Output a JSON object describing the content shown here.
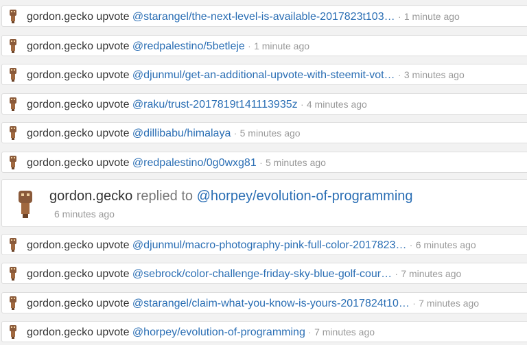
{
  "feed": [
    {
      "user": "gordon.gecko",
      "action": "upvote",
      "target": "@starangel/the-next-level-is-available-2017823t103…",
      "time": "1 minute ago"
    },
    {
      "user": "gordon.gecko",
      "action": "upvote",
      "target": "@redpalestino/5betleje",
      "time": "1 minute ago"
    },
    {
      "user": "gordon.gecko",
      "action": "upvote",
      "target": "@djunmul/get-an-additional-upvote-with-steemit-vot…",
      "time": "3 minutes ago"
    },
    {
      "user": "gordon.gecko",
      "action": "upvote",
      "target": "@raku/trust-2017819t141113935z",
      "time": "4 minutes ago"
    },
    {
      "user": "gordon.gecko",
      "action": "upvote",
      "target": "@dillibabu/himalaya",
      "time": "5 minutes ago"
    },
    {
      "user": "gordon.gecko",
      "action": "upvote",
      "target": "@redpalestino/0g0wxg81",
      "time": "5 minutes ago"
    },
    {
      "user": "gordon.gecko",
      "action": "replied to",
      "target": "@horpey/evolution-of-programming",
      "time": "6 minutes ago"
    },
    {
      "user": "gordon.gecko",
      "action": "upvote",
      "target": "@djunmul/macro-photography-pink-full-color-2017823…",
      "time": "6 minutes ago"
    },
    {
      "user": "gordon.gecko",
      "action": "upvote",
      "target": "@sebrock/color-challenge-friday-sky-blue-golf-cour…",
      "time": "7 minutes ago"
    },
    {
      "user": "gordon.gecko",
      "action": "upvote",
      "target": "@starangel/claim-what-you-know-is-yours-2017824t10…",
      "time": "7 minutes ago"
    },
    {
      "user": "gordon.gecko",
      "action": "upvote",
      "target": "@horpey/evolution-of-programming",
      "time": "7 minutes ago"
    }
  ],
  "separator": "·",
  "colors": {
    "link": "#2a6eb4",
    "text": "#333333",
    "muted": "#999999"
  },
  "avatar_icon": "robot-figure-icon"
}
